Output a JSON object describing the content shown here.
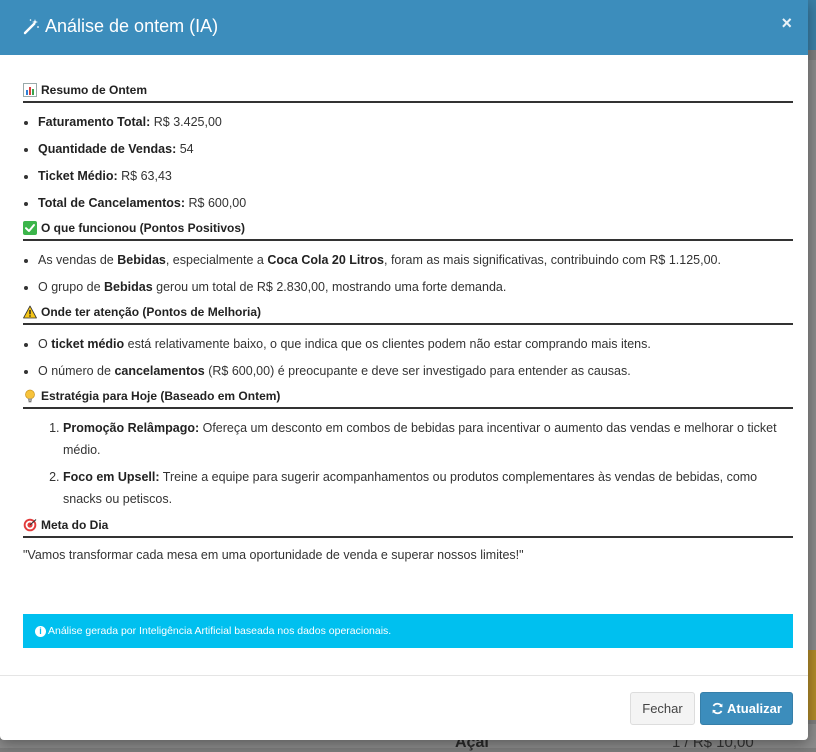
{
  "modal": {
    "title": "Análise de ontem (IA)",
    "close_glyph": "×"
  },
  "sections": {
    "resumo": {
      "title": "Resumo de Ontem",
      "icon": "bar-chart-icon",
      "items": [
        {
          "label": "Faturamento Total:",
          "value": "R$ 3.425,00"
        },
        {
          "label": "Quantidade de Vendas:",
          "value": "54"
        },
        {
          "label": "Ticket Médio:",
          "value": "R$ 63,43"
        },
        {
          "label": "Total de Cancelamentos:",
          "value": "R$ 600,00"
        }
      ]
    },
    "positivos": {
      "title": "O que funcionou (Pontos Positivos)",
      "icon": "check-icon",
      "items": [
        {
          "t1": "As vendas de ",
          "b1": "Bebidas",
          "t2": ", especialmente a ",
          "b2": "Coca Cola 20 Litros",
          "t3": ", foram as mais significativas, contribuindo com R$ 1.125,00."
        },
        {
          "t1": "O grupo de ",
          "b1": "Bebidas",
          "t2": " gerou um total de R$ 2.830,00, mostrando uma forte demanda."
        }
      ]
    },
    "melhoria": {
      "title": "Onde ter atenção (Pontos de Melhoria)",
      "icon": "warning-icon",
      "items": [
        {
          "t1": "O ",
          "b1": "ticket médio",
          "t2": " está relativamente baixo, o que indica que os clientes podem não estar comprando mais itens."
        },
        {
          "t1": "O número de ",
          "b1": "cancelamentos",
          "t2": " (R$ 600,00) é preocupante e deve ser investigado para entender as causas."
        }
      ]
    },
    "estrategia": {
      "title": "Estratégia para Hoje (Baseado em Ontem)",
      "icon": "lightbulb-icon",
      "items": [
        {
          "label": "Promoção Relâmpago:",
          "text": " Ofereça um desconto em combos de bebidas para incentivar o aumento das vendas e melhorar o ticket médio."
        },
        {
          "label": "Foco em Upsell:",
          "text": " Treine a equipe para sugerir acompanhamentos ou produtos complementares às vendas de bebidas, como snacks ou petiscos."
        }
      ]
    },
    "meta": {
      "title": "Meta do Dia",
      "icon": "target-icon",
      "quote": "\"Vamos transformar cada mesa em uma oportunidade de venda e superar nossos limites!\""
    }
  },
  "alert": {
    "icon": "info-icon",
    "text": "Análise gerada por Inteligência Artificial baseada nos dados operacionais."
  },
  "footer": {
    "close_label": "Fechar",
    "refresh_label": "Atualizar"
  },
  "background": {
    "item_name": "Açaí",
    "item_price": "1 / R$ 10,00"
  },
  "colors": {
    "header": "#3c8dbc",
    "alert": "#00c0ef",
    "primary_button": "#3c8dbc"
  }
}
